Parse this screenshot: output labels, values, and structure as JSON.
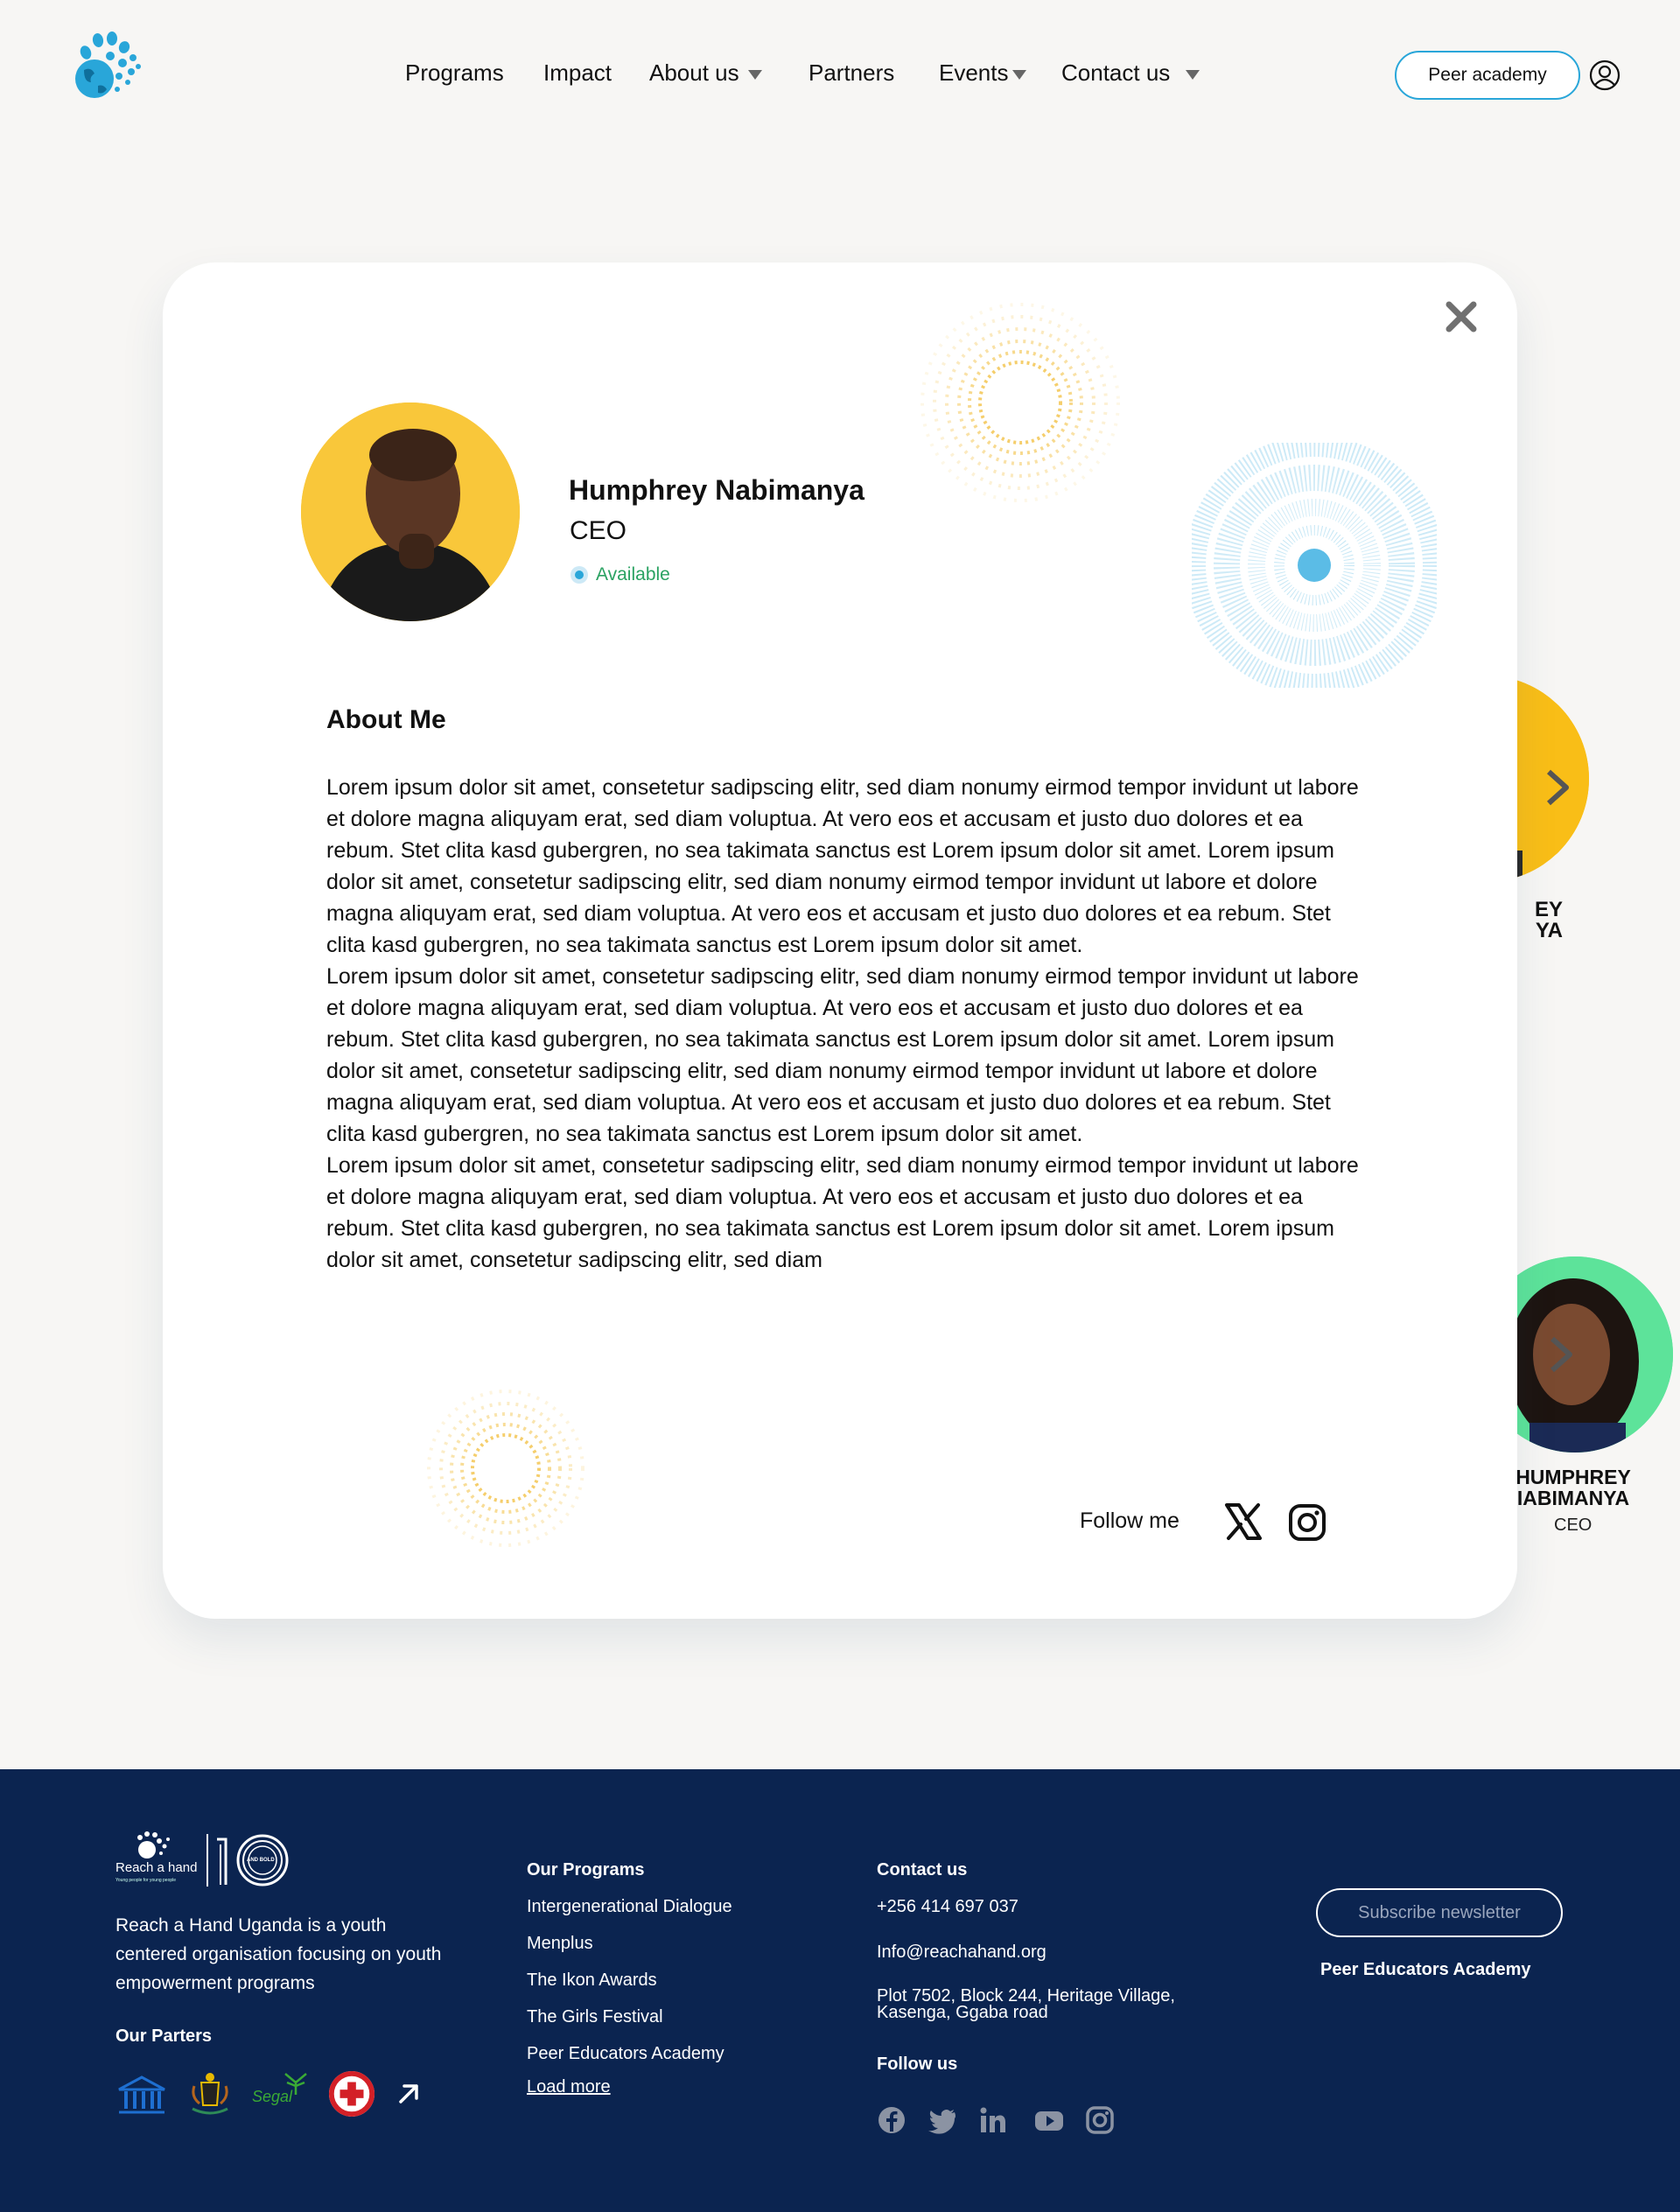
{
  "nav": {
    "items": [
      {
        "label": "Programs"
      },
      {
        "label": "Impact"
      },
      {
        "label": "About us"
      },
      {
        "label": "Partners"
      },
      {
        "label": "Events"
      },
      {
        "label": "Contact us"
      }
    ],
    "cta_label": "Peer academy"
  },
  "profile": {
    "name": "Humphrey Nabimanya",
    "role": "CEO",
    "status": "Available",
    "about_title": "About Me",
    "paragraphs": [
      "Lorem ipsum dolor sit amet, consetetur sadipscing elitr, sed diam nonumy eirmod tempor invidunt ut labore et dolore magna aliquyam erat, sed diam voluptua. At vero eos et accusam et justo duo dolores et ea rebum. Stet clita kasd gubergren, no sea takimata sanctus est Lorem ipsum dolor sit amet. Lorem ipsum dolor sit amet, consetetur sadipscing elitr, sed diam nonumy eirmod tempor invidunt ut labore et dolore magna aliquyam erat, sed diam voluptua. At vero eos et accusam et justo duo dolores et ea rebum. Stet clita kasd gubergren, no sea takimata sanctus est Lorem ipsum dolor sit amet.",
      "Lorem ipsum dolor sit amet, consetetur sadipscing elitr, sed diam nonumy eirmod tempor invidunt ut labore et dolore magna aliquyam erat, sed diam voluptua. At vero eos et accusam et justo duo dolores et ea rebum. Stet clita kasd gubergren, no sea takimata sanctus est Lorem ipsum dolor sit amet. Lorem ipsum dolor sit amet, consetetur sadipscing elitr, sed diam nonumy eirmod tempor invidunt ut labore et dolore magna aliquyam erat, sed diam voluptua. At vero eos et accusam et justo duo dolores et ea rebum. Stet clita kasd gubergren, no sea takimata sanctus est Lorem ipsum dolor sit amet.",
      "Lorem ipsum dolor sit amet, consetetur sadipscing elitr, sed diam nonumy eirmod tempor invidunt ut labore et dolore magna aliquyam erat, sed diam voluptua. At vero eos et accusam et justo duo dolores et ea rebum. Stet clita kasd gubergren, no sea takimata sanctus est Lorem ipsum dolor sit amet. Lorem ipsum dolor sit amet, consetetur sadipscing elitr, sed diam"
    ],
    "follow_label": "Follow me"
  },
  "background_cards": [
    {
      "name_line1": "EY",
      "name_line2": "YA"
    },
    {
      "name_line1": "HUMPHREY",
      "name_line2": "IABIMANYA",
      "role": "CEO"
    }
  ],
  "footer": {
    "logo_text": "Reach a hand",
    "logo_tagline": "Young people for young people",
    "logo_badge": "AND BOLD",
    "description": "Reach a Hand Uganda is a youth centered organisation focusing on youth empowerment programs",
    "partners_title": "Our Parters",
    "partner_logo_text": "Segal",
    "programs_title": "Our Programs",
    "programs": [
      "Intergenerational Dialogue",
      "Menplus",
      "The Ikon Awards",
      "The Girls Festival",
      "Peer Educators Academy"
    ],
    "load_more": "Load more",
    "contact_title": "Contact us",
    "phone": "+256 414 697 037",
    "email": "Info@reachahand.org",
    "address_line1": "Plot 7502, Block 244, Heritage Village,",
    "address_line2": "Kasenga, Ggaba road",
    "follow_title": "Follow us",
    "subscribe_label": "Subscribe newsletter",
    "academy_link": "Peer Educators Academy"
  },
  "colors": {
    "brand_blue": "#29a6d9",
    "footer_bg": "#0b2450",
    "avatar_yellow": "#f9c73a",
    "available_green": "#2aa262",
    "card_green": "#5de39a"
  }
}
